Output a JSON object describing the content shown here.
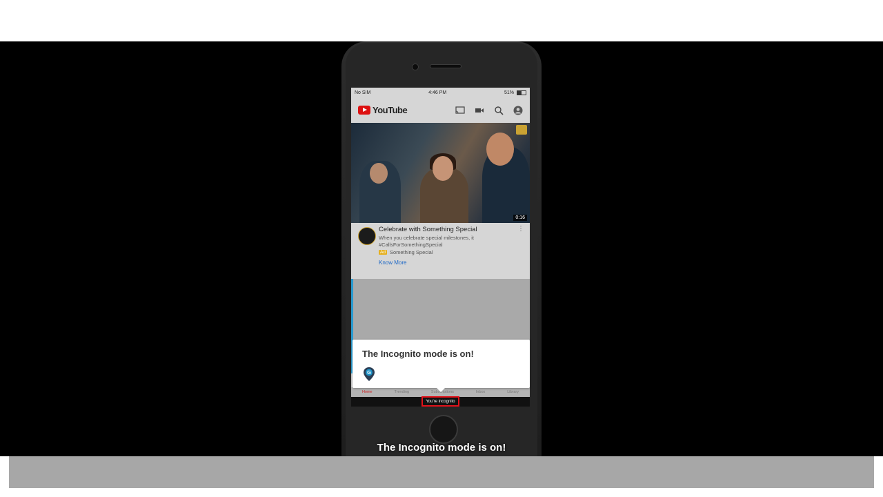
{
  "status_bar": {
    "carrier": "No SIM",
    "time": "4:46 PM",
    "battery": "51%",
    "battery_level": 0.51
  },
  "header": {
    "app_name": "YouTube",
    "icons": [
      "cast-icon",
      "camera-icon",
      "search-icon",
      "account-icon"
    ]
  },
  "video": {
    "duration": "0:16",
    "title": "Celebrate with Something Special",
    "description_line1": "When you celebrate special milestones, it",
    "description_line2": "#CallsForSomethingSpecial",
    "ad_badge": "Ad",
    "channel": "Something Special",
    "cta": "Know More"
  },
  "tabbar": {
    "items": [
      "Home",
      "Trending",
      "Subscriptions",
      "Inbox",
      "Library"
    ]
  },
  "incognito_label": "You're incognito",
  "tooltip": {
    "title": "The Incognito mode is on!"
  },
  "caption": "The Incognito mode is on!",
  "colors": {
    "brand_red": "#dd1111",
    "highlight": "#e3121a",
    "link": "#1a66c5"
  }
}
